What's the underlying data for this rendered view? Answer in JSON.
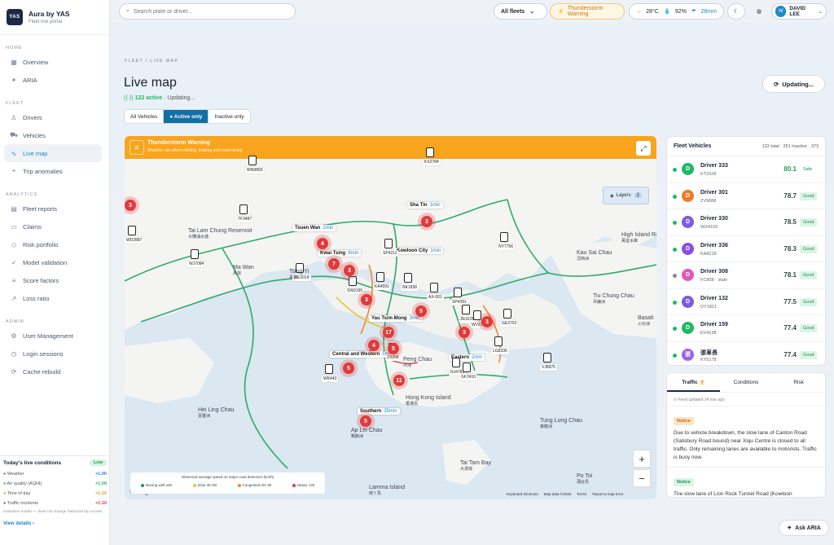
{
  "brand": {
    "logo": "YAS",
    "name": "Aura by YAS",
    "subtitle": "Fleet risk portal"
  },
  "sidebar": {
    "sections": [
      {
        "title": "HOME",
        "items": [
          {
            "label": "Overview",
            "icon": "grid-icon"
          },
          {
            "label": "ARIA",
            "icon": "sparkle-icon"
          }
        ]
      },
      {
        "title": "FLEET",
        "items": [
          {
            "label": "Drivers",
            "icon": "users-icon"
          },
          {
            "label": "Vehicles",
            "icon": "car-icon"
          },
          {
            "label": "Live map",
            "icon": "pulse-icon",
            "active": true
          },
          {
            "label": "Trip anomalies",
            "icon": "route-icon"
          }
        ]
      },
      {
        "title": "ANALYTICS",
        "items": [
          {
            "label": "Fleet reports",
            "icon": "chart-icon"
          },
          {
            "label": "Claims",
            "icon": "document-icon"
          },
          {
            "label": "Risk portfolio",
            "icon": "shield-icon"
          },
          {
            "label": "Model validation",
            "icon": "check-icon"
          },
          {
            "label": "Score factors",
            "icon": "sliders-icon"
          },
          {
            "label": "Loss ratio",
            "icon": "trend-icon"
          }
        ]
      },
      {
        "title": "ADMIN",
        "items": [
          {
            "label": "User Management",
            "icon": "user-cog-icon"
          },
          {
            "label": "Login sessions",
            "icon": "clock-icon"
          },
          {
            "label": "Cache rebuild",
            "icon": "refresh-icon"
          }
        ]
      }
    ]
  },
  "live_conditions": {
    "title": "Today's live conditions",
    "badge": "Low",
    "rows": [
      {
        "label": "Weather",
        "value": "×1.00",
        "color": "#1e88c8"
      },
      {
        "label": "Air quality (AQHI)",
        "value": "×1.00",
        "color": "#1fb865"
      },
      {
        "label": "Time of day",
        "value": "×1.10",
        "color": "#e0a020"
      },
      {
        "label": "Traffic incidents",
        "value": "×1.10",
        "color": "#e03a3a"
      }
    ],
    "note": "Indicative model — does not change historical trip scores",
    "link": "View details ›"
  },
  "topbar": {
    "search_placeholder": "Search plate or driver...",
    "fleet_select": "All fleets",
    "weather_warning": "Thunderstorm Warning",
    "temp": "28°C",
    "humidity": "92%",
    "rain": "28mm",
    "user_initial": "W",
    "user_name": "DAVID LEE"
  },
  "page": {
    "breadcrumb": "FLEET  /  LIVE MAP",
    "title": "Live map",
    "active_count": "122 active",
    "status": "· Updating...",
    "filters": [
      "All Vehicles",
      "Active only",
      "Inactive only"
    ],
    "update_button": "Updating..."
  },
  "map": {
    "warning_title": "Thunderstorm Warning",
    "warning_sub": "Weather can affect visibility, braking and route timing.",
    "layers_label": "Layers",
    "layers_count": "2",
    "zoom_in": "+",
    "zoom_out": "−",
    "legend_title": "Observed average speed on major-road detectors (km/h)",
    "legend": [
      {
        "label": "Moving well ≥60",
        "color": "#1c9a55"
      },
      {
        "label": "Slow 40–59",
        "color": "#e6c21f"
      },
      {
        "label": "Congested 20–39",
        "color": "#ef8a2a"
      },
      {
        "label": "Heavy <20",
        "color": "#e03a3a"
      }
    ],
    "google": "Google",
    "attribution": [
      "Keyboard shortcuts",
      "Map data ©2026",
      "Terms",
      "Report a map error"
    ],
    "places": [
      {
        "name": "Sha Tin",
        "eta": "1min"
      },
      {
        "name": "Tsuen Wan",
        "eta": "2min"
      },
      {
        "name": "Kwai Tsing",
        "eta": "8min"
      },
      {
        "name": "Kowloon City",
        "eta": "1min"
      },
      {
        "name": "Yau Tsim Mong",
        "eta": "3min"
      },
      {
        "name": "Central and Western",
        "eta": "5min"
      },
      {
        "name": "Eastern",
        "eta": "2min"
      },
      {
        "name": "Southern",
        "eta": "35min"
      }
    ],
    "plates": [
      "WN9893",
      "KX2784",
      "TF3487",
      "WD2887",
      "WJ7084",
      "ME2018",
      "SP4211",
      "NY7756",
      "SW3195",
      "KA4591",
      "NK1838",
      "AX-001",
      "SP4281",
      "ZE9195",
      "WV2310",
      "GE3793",
      "LG8336",
      "NJ4781",
      "GF2410",
      "VJ8975",
      "WK443",
      "ZX208"
    ],
    "cluster_counts": [
      "3",
      "4",
      "7",
      "3",
      "3",
      "5",
      "3",
      "3",
      "4",
      "17",
      "3",
      "5",
      "11",
      "5",
      "5"
    ],
    "labels": [
      {
        "text": "Tai Lam Chung Reservoir",
        "sub": "大欖涌水塘"
      },
      {
        "text": "Ma Wan",
        "sub": "馬灣"
      },
      {
        "text": "Tsing Yi",
        "sub": "青衣"
      },
      {
        "text": "Kau Sai Chau",
        "sub": "滘西洲"
      },
      {
        "text": "High Island Reservoir",
        "sub": "萬宜水庫"
      },
      {
        "text": "Tiu Chung Chau",
        "sub": "吊鐘洲"
      },
      {
        "text": "Basalt",
        "sub": "火石洲"
      },
      {
        "text": "Peng Chau",
        "sub": "坪洲"
      },
      {
        "text": "Hei Ling Chau",
        "sub": "喜靈洲"
      },
      {
        "text": "Hong Kong Island",
        "sub": "香港島"
      },
      {
        "text": "Ap Lei Chau",
        "sub": "鴨脷洲"
      },
      {
        "text": "Tung Lung Chau",
        "sub": "東龍洲"
      },
      {
        "text": "Lamma Island",
        "sub": "南丫島"
      },
      {
        "text": "Tai Tam Bay",
        "sub": "大潭灣"
      },
      {
        "text": "Po Toi",
        "sub": "蒲台島"
      }
    ]
  },
  "fleet_panel": {
    "title": "Fleet Vehicles",
    "summary": "122 total · 251 inactive · 373",
    "drivers": [
      {
        "name": "Driver 333",
        "plate": "KT1028",
        "score": "80.1",
        "badge": "Safe",
        "avatar": "D",
        "color": "#1fb865",
        "dot": "green"
      },
      {
        "name": "Driver 301",
        "plate": "ZV9688",
        "score": "78.7",
        "badge": "Good",
        "avatar": "D",
        "color": "#ef7a2a",
        "dot": "green"
      },
      {
        "name": "Driver 330",
        "plate": "WX4103",
        "score": "78.5",
        "badge": "Good",
        "avatar": "D",
        "color": "#7a5ce0",
        "dot": "green"
      },
      {
        "name": "Driver 336",
        "plate": "KA8218",
        "score": "78.3",
        "badge": "Good",
        "avatar": "D",
        "color": "#8b4ee0",
        "dot": "green"
      },
      {
        "name": "Driver 308",
        "plate": "FC808 · stale",
        "score": "78.1",
        "badge": "Good",
        "avatar": "D",
        "color": "#e056b8",
        "dot": "grey"
      },
      {
        "name": "Driver 132",
        "plate": "DY1821",
        "score": "77.5",
        "badge": "Good",
        "avatar": "D",
        "color": "#7a5ce0",
        "dot": "green"
      },
      {
        "name": "Driver 159",
        "plate": "EV4138",
        "score": "77.4",
        "badge": "Good",
        "avatar": "D",
        "color": "#1fb865",
        "dot": "green"
      },
      {
        "name": "張車長",
        "plate": "KY5178",
        "score": "77.4",
        "badge": "Good",
        "avatar": "張",
        "color": "#9b62e8",
        "dot": "green"
      }
    ]
  },
  "traffic_panel": {
    "tabs": [
      {
        "label": "Traffic",
        "count": "7"
      },
      {
        "label": "Conditions"
      },
      {
        "label": "Risk"
      }
    ],
    "updated": "⊙ Feed updated 24 min ago",
    "notices": [
      {
        "tag": "Notice",
        "tag_color": "#fde3c5",
        "tag_text_color": "#c66a00",
        "text": "Due to vehicle breakdown, the slow lane of Canton Road (Salisbury Road bound) near Xiqu Centre is closed to all traffic. Only remaining lanes are available to motorists. Traffic is busy now."
      },
      {
        "tag": "Notice",
        "tag_color": "#dcf4e6",
        "tag_text_color": "#1a8f4f",
        "text": "The slow lane of Lion Rock Tunnel Road (Kowloon"
      }
    ]
  },
  "ask_button": "Ask ARIA"
}
